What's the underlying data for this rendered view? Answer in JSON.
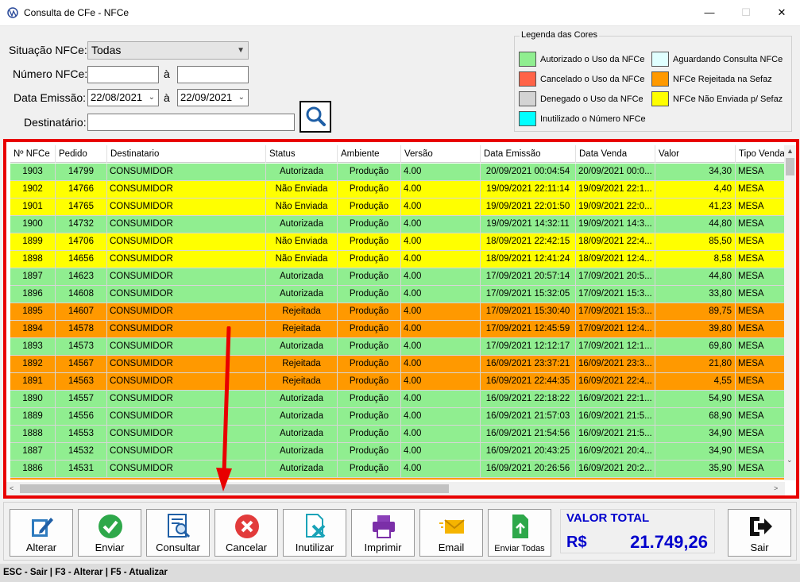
{
  "window": {
    "title": "Consulta de CFe - NFCe",
    "minimize": "—",
    "maximize": "☐",
    "close": "✕"
  },
  "filters": {
    "situacao_label": "Situação NFCe:",
    "situacao_value": "Todas",
    "numero_label": "Número NFCe:",
    "numero_from": "",
    "a1": "à",
    "numero_to": "",
    "data_label": "Data Emissão:",
    "data_from": "22/08/2021",
    "a2": "à",
    "data_to": "22/09/2021",
    "dest_label": "Destinatário:",
    "dest_value": ""
  },
  "legend": {
    "title": "Legenda das Cores",
    "items": [
      {
        "label": "Autorizado o Uso da NFCe",
        "color": "#90ee90"
      },
      {
        "label": "Cancelado o Uso da NFCe",
        "color": "#ff6347"
      },
      {
        "label": "Denegado o Uso da NFCe",
        "color": "#d3d3d3"
      },
      {
        "label": "Inutilizado o Número NFCe",
        "color": "#00ffff"
      },
      {
        "label": "Aguardando Consulta NFCe",
        "color": "#e0ffff"
      },
      {
        "label": "NFCe Rejeitada na Sefaz",
        "color": "#ff9900"
      },
      {
        "label": "NFCe Não Enviada p/ Sefaz",
        "color": "#ffff00"
      }
    ]
  },
  "grid": {
    "headers": [
      "Nº NFCe",
      "Pedido",
      "Destinatario",
      "Status",
      "Ambiente",
      "Versão",
      "Data Emissão",
      "Data Venda",
      "Valor",
      "Tipo Venda"
    ],
    "colors": {
      "Autorizada": "#90ee90",
      "Não Enviada": "#ffff00",
      "Rejeitada": "#ff9900"
    },
    "rows": [
      [
        "1903",
        "14799",
        "CONSUMIDOR",
        "Autorizada",
        "Produção",
        "4.00",
        "20/09/2021 00:04:54",
        "20/09/2021 00:0...",
        "34,30",
        "MESA"
      ],
      [
        "1902",
        "14766",
        "CONSUMIDOR",
        "Não Enviada",
        "Produção",
        "4.00",
        "19/09/2021 22:11:14",
        "19/09/2021 22:1...",
        "4,40",
        "MESA"
      ],
      [
        "1901",
        "14765",
        "CONSUMIDOR",
        "Não Enviada",
        "Produção",
        "4.00",
        "19/09/2021 22:01:50",
        "19/09/2021 22:0...",
        "41,23",
        "MESA"
      ],
      [
        "1900",
        "14732",
        "CONSUMIDOR",
        "Autorizada",
        "Produção",
        "4.00",
        "19/09/2021 14:32:11",
        "19/09/2021 14:3...",
        "44,80",
        "MESA"
      ],
      [
        "1899",
        "14706",
        "CONSUMIDOR",
        "Não Enviada",
        "Produção",
        "4.00",
        "18/09/2021 22:42:15",
        "18/09/2021 22:4...",
        "85,50",
        "MESA"
      ],
      [
        "1898",
        "14656",
        "CONSUMIDOR",
        "Não Enviada",
        "Produção",
        "4.00",
        "18/09/2021 12:41:24",
        "18/09/2021 12:4...",
        "8,58",
        "MESA"
      ],
      [
        "1897",
        "14623",
        "CONSUMIDOR",
        "Autorizada",
        "Produção",
        "4.00",
        "17/09/2021 20:57:14",
        "17/09/2021 20:5...",
        "44,80",
        "MESA"
      ],
      [
        "1896",
        "14608",
        "CONSUMIDOR",
        "Autorizada",
        "Produção",
        "4.00",
        "17/09/2021 15:32:05",
        "17/09/2021 15:3...",
        "33,80",
        "MESA"
      ],
      [
        "1895",
        "14607",
        "CONSUMIDOR",
        "Rejeitada",
        "Produção",
        "4.00",
        "17/09/2021 15:30:40",
        "17/09/2021 15:3...",
        "89,75",
        "MESA"
      ],
      [
        "1894",
        "14578",
        "CONSUMIDOR",
        "Rejeitada",
        "Produção",
        "4.00",
        "17/09/2021 12:45:59",
        "17/09/2021 12:4...",
        "39,80",
        "MESA"
      ],
      [
        "1893",
        "14573",
        "CONSUMIDOR",
        "Autorizada",
        "Produção",
        "4.00",
        "17/09/2021 12:12:17",
        "17/09/2021 12:1...",
        "69,80",
        "MESA"
      ],
      [
        "1892",
        "14567",
        "CONSUMIDOR",
        "Rejeitada",
        "Produção",
        "4.00",
        "16/09/2021 23:37:21",
        "16/09/2021 23:3...",
        "21,80",
        "MESA"
      ],
      [
        "1891",
        "14563",
        "CONSUMIDOR",
        "Rejeitada",
        "Produção",
        "4.00",
        "16/09/2021 22:44:35",
        "16/09/2021 22:4...",
        "4,55",
        "MESA"
      ],
      [
        "1890",
        "14557",
        "CONSUMIDOR",
        "Autorizada",
        "Produção",
        "4.00",
        "16/09/2021 22:18:22",
        "16/09/2021 22:1...",
        "54,90",
        "MESA"
      ],
      [
        "1889",
        "14556",
        "CONSUMIDOR",
        "Autorizada",
        "Produção",
        "4.00",
        "16/09/2021 21:57:03",
        "16/09/2021 21:5...",
        "68,90",
        "MESA"
      ],
      [
        "1888",
        "14553",
        "CONSUMIDOR",
        "Autorizada",
        "Produção",
        "4.00",
        "16/09/2021 21:54:56",
        "16/09/2021 21:5...",
        "34,90",
        "MESA"
      ],
      [
        "1887",
        "14532",
        "CONSUMIDOR",
        "Autorizada",
        "Produção",
        "4.00",
        "16/09/2021 20:43:25",
        "16/09/2021 20:4...",
        "34,90",
        "MESA"
      ],
      [
        "1886",
        "14531",
        "CONSUMIDOR",
        "Autorizada",
        "Produção",
        "4.00",
        "16/09/2021 20:26:56",
        "16/09/2021 20:2...",
        "35,90",
        "MESA"
      ]
    ]
  },
  "toolbar": {
    "buttons": [
      {
        "label": "Alterar",
        "icon": "edit-icon"
      },
      {
        "label": "Enviar",
        "icon": "check-icon"
      },
      {
        "label": "Consultar",
        "icon": "document-search-icon"
      },
      {
        "label": "Cancelar",
        "icon": "cancel-icon"
      },
      {
        "label": "Inutilizar",
        "icon": "file-x-icon"
      },
      {
        "label": "Imprimir",
        "icon": "printer-icon"
      },
      {
        "label": "Email",
        "icon": "mail-icon"
      },
      {
        "label": "Enviar Todas",
        "icon": "file-upload-icon"
      }
    ],
    "total_label": "VALOR TOTAL",
    "total_currency": "R$",
    "total_value": "21.749,26",
    "exit_label": "Sair"
  },
  "statusbar": "ESC - Sair | F3 - Alterar  |  F5 - Atualizar"
}
